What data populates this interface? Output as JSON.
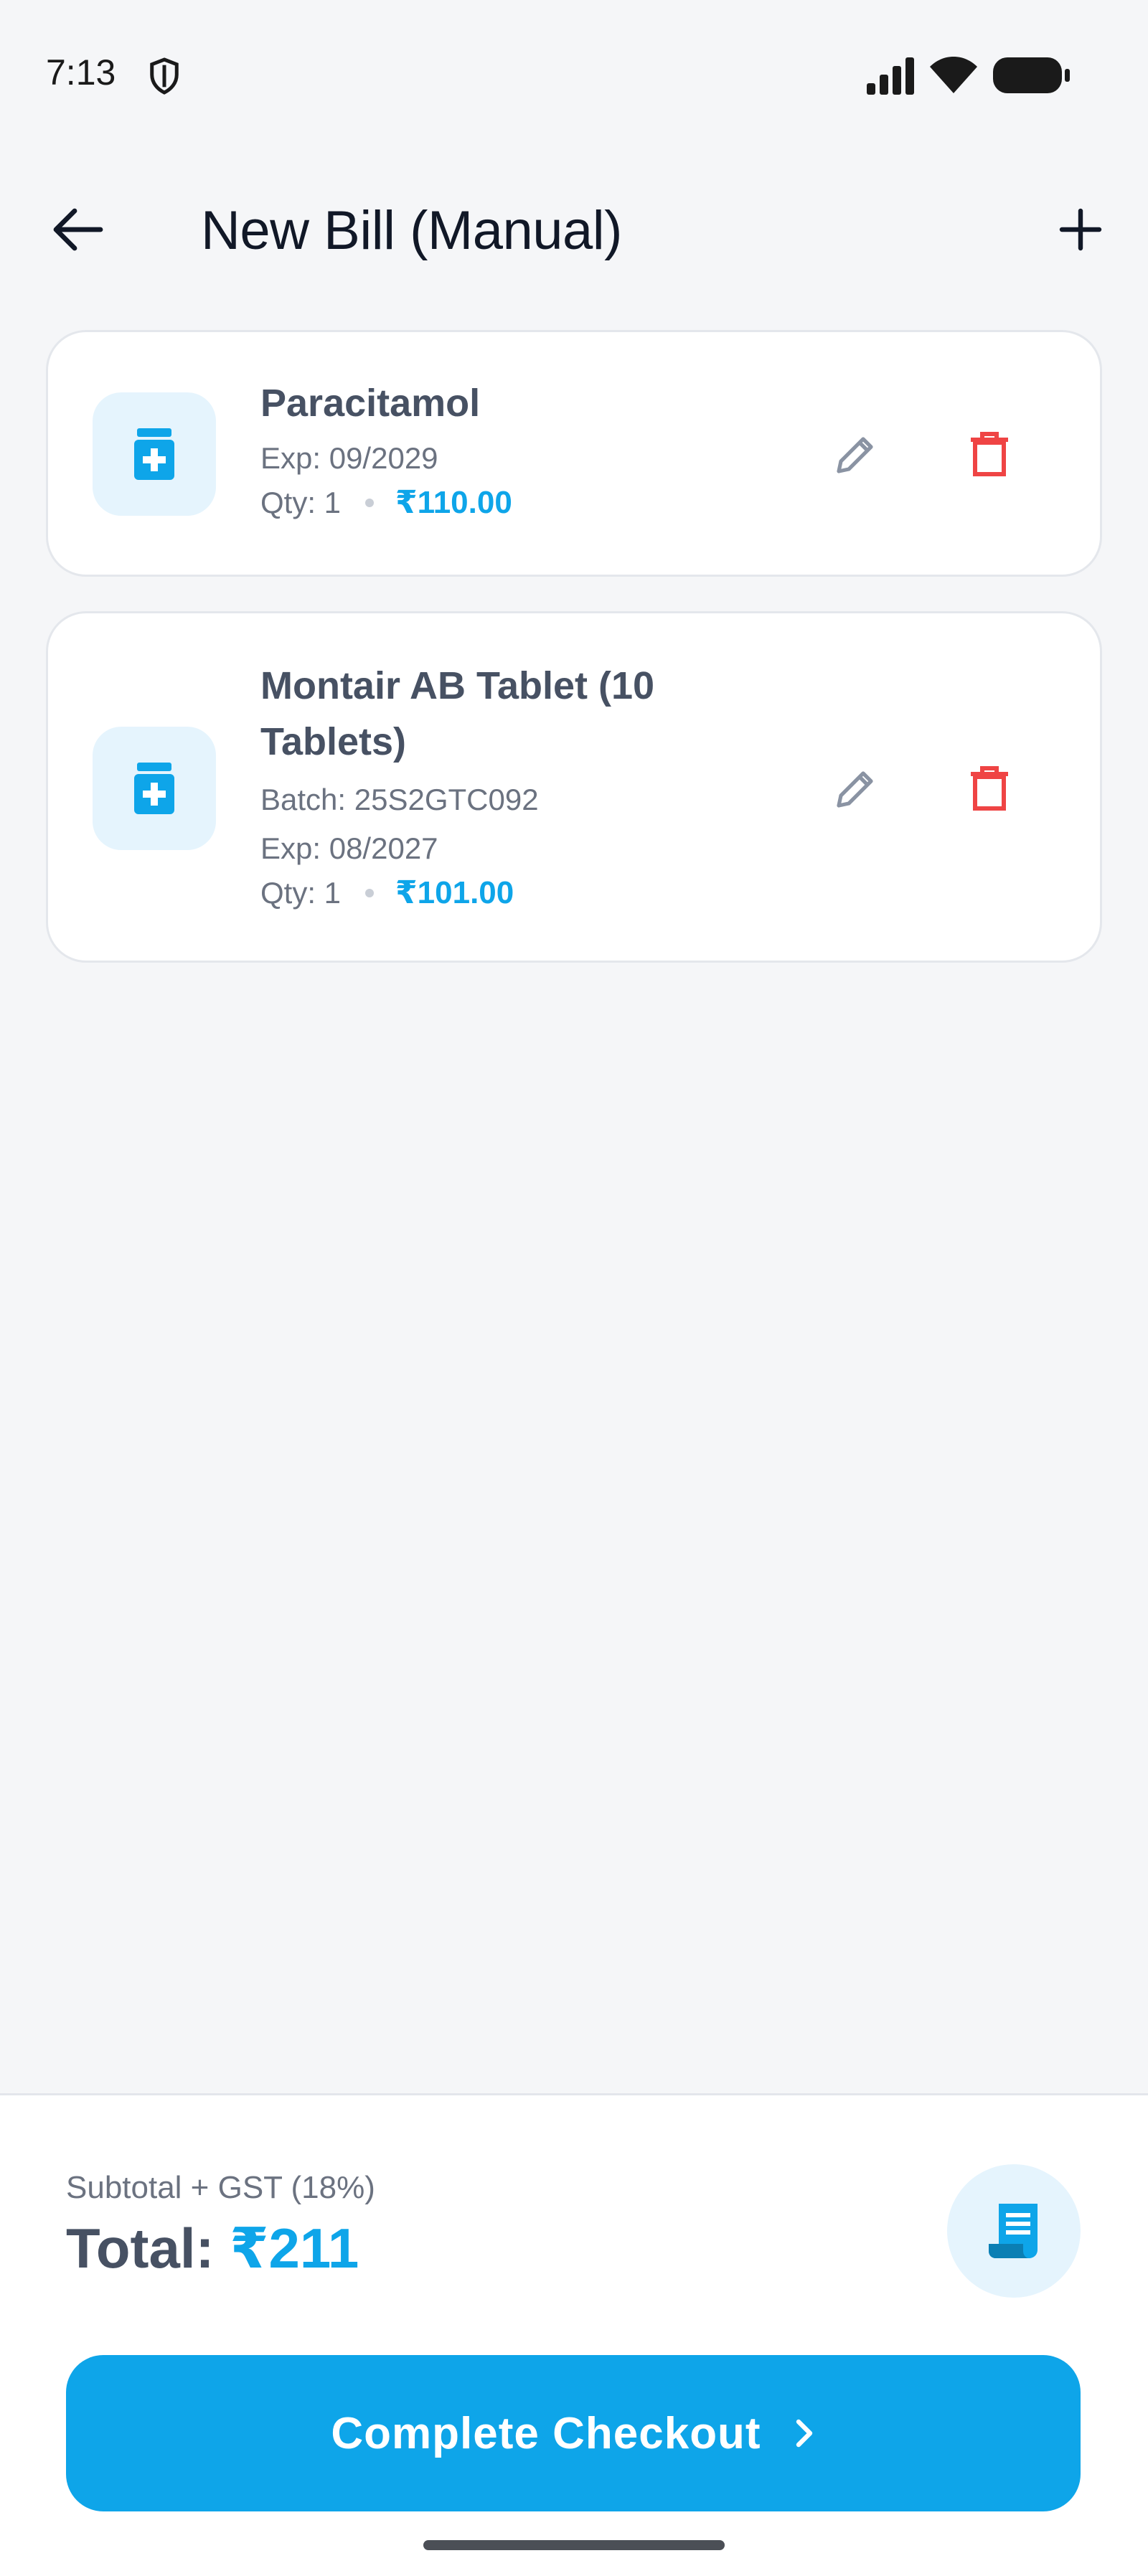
{
  "status_bar": {
    "time": "7:13",
    "icons": [
      "shield-icon",
      "signal-icon",
      "wifi-icon",
      "battery-icon"
    ]
  },
  "header": {
    "title": "New Bill (Manual)",
    "back_icon": "arrow-left-icon",
    "add_icon": "plus-icon"
  },
  "items": [
    {
      "name": "Paracitamol",
      "exp": "Exp: 09/2029",
      "qty": "Qty: 1",
      "price": "₹110.00"
    },
    {
      "name_line1": "Montair AB Tablet (10",
      "name_line2": "Tablets)",
      "batch": "Batch: 25S2GTC092",
      "exp": "Exp: 08/2027",
      "qty": "Qty: 1",
      "price": "₹101.00"
    }
  ],
  "summary": {
    "subtotal_label": "Subtotal + GST (18%)",
    "total_label": "Total:",
    "total_amount": "₹211",
    "checkout_label": "Complete Checkout"
  },
  "colors": {
    "accent": "#0ea5e9",
    "accent_light": "#e5f4fd",
    "delete": "#ef4444",
    "edit": "#8a93a3",
    "background": "#f5f6f8"
  }
}
